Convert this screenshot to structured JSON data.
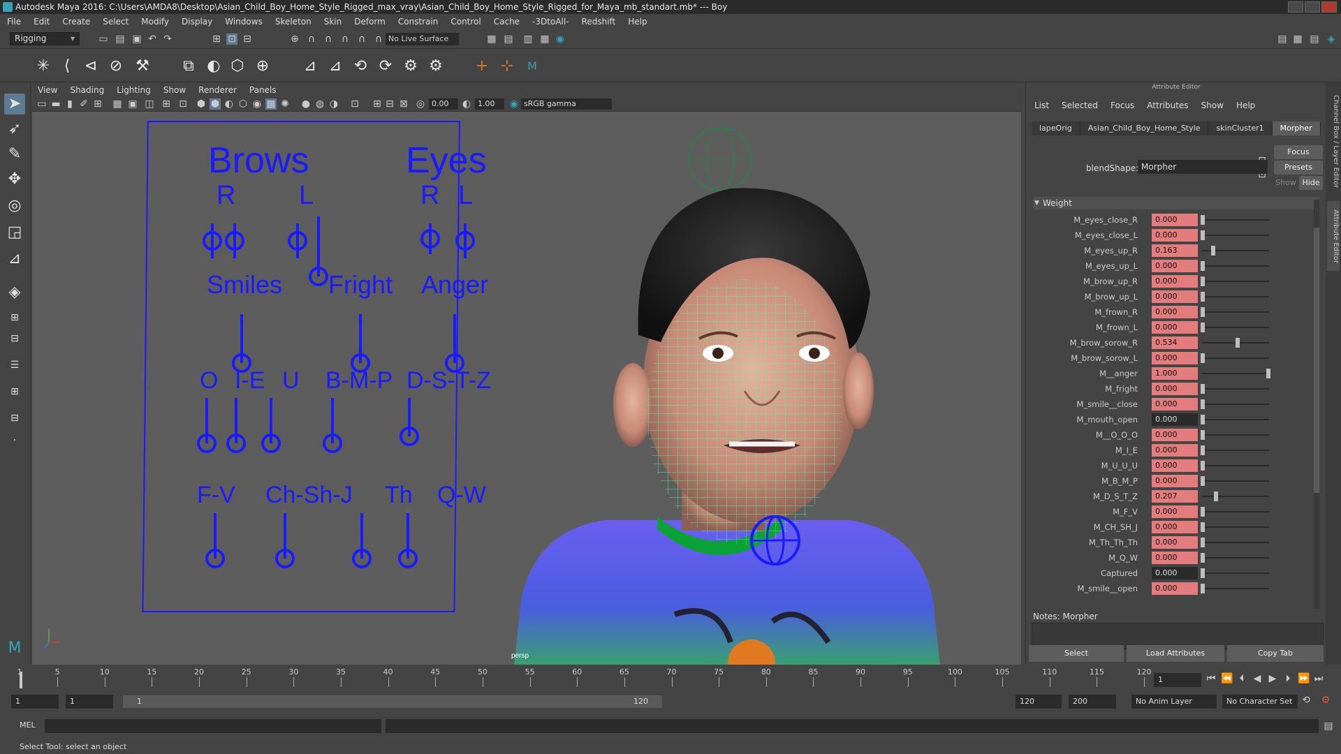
{
  "window": {
    "title": "Autodesk Maya 2016: C:\\Users\\AMDA8\\Desktop\\Asian_Child_Boy_Home_Style_Rigged_max_vray\\Asian_Child_Boy_Home_Style_Rigged_for_Maya_mb_standart.mb*   ---   Boy"
  },
  "menubar": [
    "File",
    "Edit",
    "Create",
    "Select",
    "Modify",
    "Display",
    "Windows",
    "Skeleton",
    "Skin",
    "Deform",
    "Constrain",
    "Control",
    "Cache",
    "-3DtoAll-",
    "Redshift",
    "Help"
  ],
  "shelf": {
    "mode": "Rigging",
    "live_surface": "No Live Surface"
  },
  "viewport": {
    "menu": [
      "View",
      "Shading",
      "Lighting",
      "Show",
      "Renderer",
      "Panels"
    ],
    "exposure": "0.00",
    "gamma": "1.00",
    "color_space": "sRGB gamma",
    "camera_label": "persp",
    "face_ui": {
      "headings": [
        "Brows",
        "Eyes",
        "Smiles",
        "Fright",
        "Anger",
        "O",
        "I-E",
        "U",
        "B-M-P",
        "D-S-T-Z",
        "F-V",
        "Ch-Sh-J",
        "Th",
        "Q-W"
      ],
      "side_labels": [
        "R",
        "L",
        "R",
        "L"
      ]
    }
  },
  "attribute_editor": {
    "title": "Attribute Editor",
    "menu": [
      "List",
      "Selected",
      "Focus",
      "Attributes",
      "Show",
      "Help"
    ],
    "tabs": [
      "lapeOrig",
      "Asian_Child_Boy_Home_Style",
      "skinCluster1",
      "Morpher"
    ],
    "active_tab": "Morpher",
    "focus_label": "Focus",
    "presets_label": "Presets",
    "show_label": "Show",
    "hide_label": "Hide",
    "blendshape_label": "blendShape:",
    "blendshape_value": "Morpher",
    "weight_section": "Weight",
    "weights": [
      {
        "name": "M_eyes_close_R",
        "value": "0.000",
        "keyed": true,
        "norm": 0.0
      },
      {
        "name": "M_eyes_close_L",
        "value": "0.000",
        "keyed": true,
        "norm": 0.0
      },
      {
        "name": "M_eyes_up_R",
        "value": "0.163",
        "keyed": true,
        "norm": 0.163
      },
      {
        "name": "M_eyes_up_L",
        "value": "0.000",
        "keyed": true,
        "norm": 0.0
      },
      {
        "name": "M_brow_up_R",
        "value": "0.000",
        "keyed": true,
        "norm": 0.0
      },
      {
        "name": "M_brow_up_L",
        "value": "0.000",
        "keyed": true,
        "norm": 0.0
      },
      {
        "name": "M_frown_R",
        "value": "0.000",
        "keyed": true,
        "norm": 0.0
      },
      {
        "name": "M_frown_L",
        "value": "0.000",
        "keyed": true,
        "norm": 0.0
      },
      {
        "name": "M_brow_sorow_R",
        "value": "0.534",
        "keyed": true,
        "norm": 0.534
      },
      {
        "name": "M_brow_sorow_L",
        "value": "0.000",
        "keyed": true,
        "norm": 0.0
      },
      {
        "name": "M__anger",
        "value": "1.000",
        "keyed": true,
        "norm": 1.0
      },
      {
        "name": "M_fright",
        "value": "0.000",
        "keyed": true,
        "norm": 0.0
      },
      {
        "name": "M_smile__close",
        "value": "0.000",
        "keyed": true,
        "norm": 0.0
      },
      {
        "name": "M_mouth_open",
        "value": "0.000",
        "keyed": false,
        "norm": 0.0
      },
      {
        "name": "M__O_O_O",
        "value": "0.000",
        "keyed": true,
        "norm": 0.0
      },
      {
        "name": "M_I_E",
        "value": "0.000",
        "keyed": true,
        "norm": 0.0
      },
      {
        "name": "M_U_U_U",
        "value": "0.000",
        "keyed": true,
        "norm": 0.0
      },
      {
        "name": "M_B_M_P",
        "value": "0.000",
        "keyed": true,
        "norm": 0.0
      },
      {
        "name": "M_D_S_T_Z",
        "value": "0.207",
        "keyed": true,
        "norm": 0.207
      },
      {
        "name": "M_F_V",
        "value": "0.000",
        "keyed": true,
        "norm": 0.0
      },
      {
        "name": "M_CH_SH_J",
        "value": "0.000",
        "keyed": true,
        "norm": 0.0
      },
      {
        "name": "M_Th_Th_Th",
        "value": "0.000",
        "keyed": true,
        "norm": 0.0
      },
      {
        "name": "M_Q_W",
        "value": "0.000",
        "keyed": true,
        "norm": 0.0
      },
      {
        "name": "Captured",
        "value": "0.000",
        "keyed": false,
        "norm": 0.0
      },
      {
        "name": "M_smile__open",
        "value": "0.000",
        "keyed": true,
        "norm": 0.0
      }
    ],
    "notes_label": "Notes:  Morpher",
    "buttons": [
      "Select",
      "Load Attributes",
      "Copy Tab"
    ]
  },
  "side_tabs": [
    "Channel Box / Layer Editor",
    "Attribute Editor"
  ],
  "timeline": {
    "ticks": [
      "1",
      "5",
      "10",
      "15",
      "20",
      "25",
      "30",
      "35",
      "40",
      "45",
      "50",
      "55",
      "60",
      "65",
      "70",
      "75",
      "80",
      "85",
      "90",
      "95",
      "100",
      "105",
      "110",
      "115",
      "120"
    ],
    "current_frame": "1"
  },
  "range": {
    "start": "1",
    "playback_start": "1",
    "slider_start": "1",
    "slider_end": "120",
    "playback_end": "120",
    "end": "200",
    "anim_layer": "No Anim Layer",
    "character_set": "No Character Set"
  },
  "command": {
    "lang": "MEL"
  },
  "help_line": "Select Tool: select an object",
  "colors": {
    "keyed_field": "#e37c7c",
    "face_ui": "#1a1aff",
    "wireframe": "#5cf0b0",
    "selection_blue": "#5f7a93"
  }
}
